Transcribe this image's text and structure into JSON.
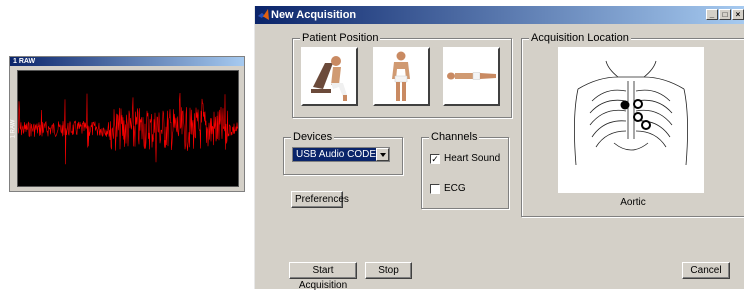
{
  "raw_window": {
    "title": "1 RAW",
    "y_label": "1 RAW",
    "signal_color": "#ff0000"
  },
  "dialog": {
    "title": "New Acquisition",
    "window_buttons": [
      "minimize-icon",
      "maximize-icon",
      "close-icon"
    ]
  },
  "patient_position": {
    "label": "Patient Position",
    "options": [
      "sitting",
      "standing",
      "supine"
    ]
  },
  "devices": {
    "label": "Devices",
    "selected": "USB Audio CODEC"
  },
  "channels": {
    "label": "Channels",
    "items": [
      {
        "label": "Heart Sound",
        "checked": true
      },
      {
        "label": "ECG",
        "checked": false
      }
    ]
  },
  "buttons": {
    "preferences": "Preferences",
    "start": "Start Acquisition",
    "stop": "Stop",
    "cancel": "Cancel"
  },
  "acquisition_location": {
    "label": "Acquisition Location",
    "selected_site": "Aortic"
  }
}
